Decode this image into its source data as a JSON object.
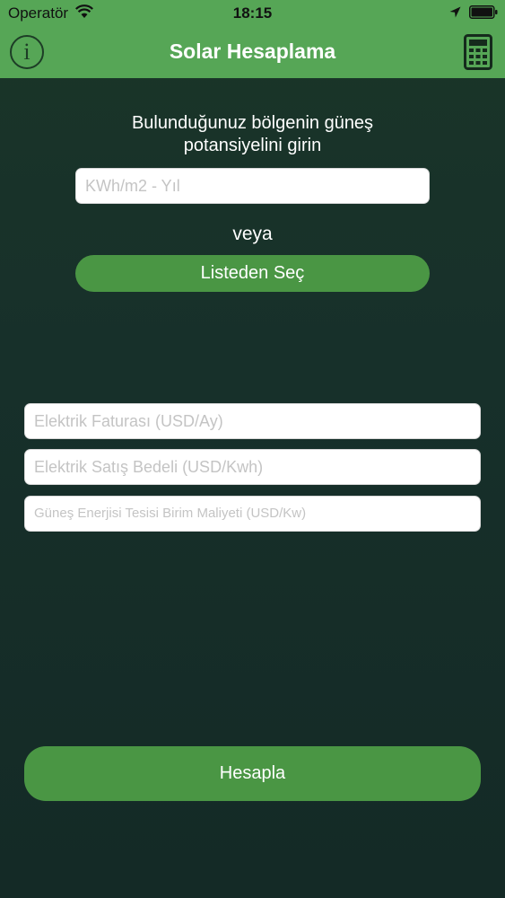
{
  "status_bar": {
    "carrier": "Operatör",
    "time": "18:15"
  },
  "nav": {
    "title": "Solar Hesaplama",
    "info_glyph": "i",
    "left_icon": "info-icon",
    "right_icon": "calculator-icon"
  },
  "form": {
    "prompt_line1": "Bulunduğunuz bölgenin güneş",
    "prompt_line2": "potansiyelini girin",
    "potential_placeholder": "KWh/m2 - Yıl",
    "or_label": "veya",
    "list_button_label": "Listeden Seç",
    "bill_placeholder": "Elektrik Faturası (USD/Ay)",
    "sale_placeholder": "Elektrik Satış Bedeli (USD/Kwh)",
    "cost_placeholder": "Güneş Enerjisi Tesisi Birim Maliyeti (USD/Kw)",
    "calculate_label": "Hesapla"
  },
  "colors": {
    "header": "#56a656",
    "button": "#4a9644",
    "background": "#17302a"
  }
}
